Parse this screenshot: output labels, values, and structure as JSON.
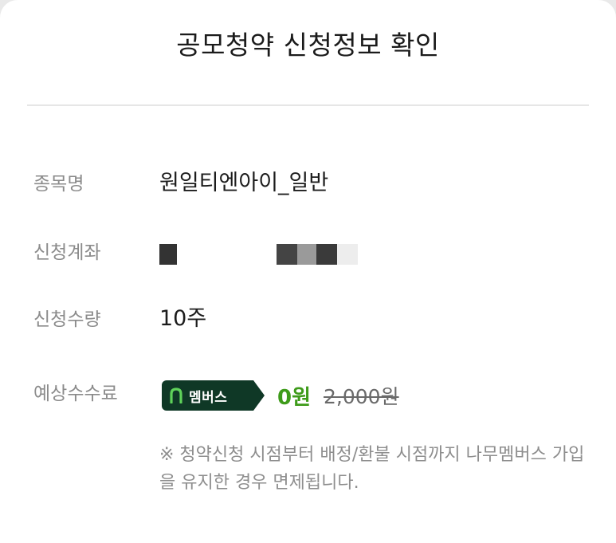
{
  "dialog": {
    "title": "공모청약 신청정보 확인"
  },
  "fields": {
    "stock_label": "종목명",
    "stock_value": "원일티엔아이_일반",
    "account_label": "신청계좌",
    "quantity_label": "신청수량",
    "quantity_value": "10주",
    "fee_label": "예상수수료"
  },
  "fee": {
    "badge_text": "멤버스",
    "badge_icon": "namuh-logo-icon",
    "discounted": "0원",
    "original": "2,000원",
    "accent_color": "#3e9b1a",
    "badge_color": "#0f3826"
  },
  "notice": {
    "text": "※ 청약신청 시점부터 배정/환불 시점까지 나무멤버스 가입을 유지한 경우 면제됩니다."
  }
}
